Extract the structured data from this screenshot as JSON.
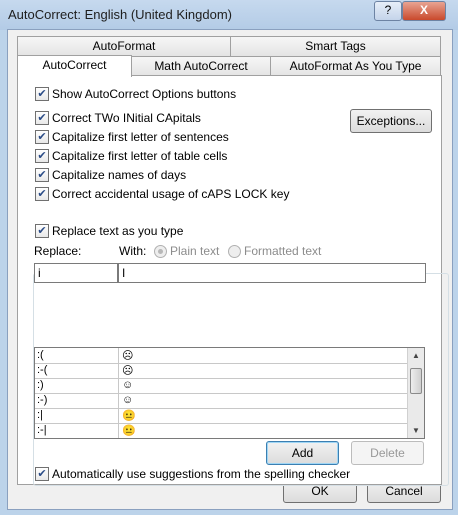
{
  "window": {
    "title": "AutoCorrect: English (United Kingdom)",
    "help_label": "?",
    "close_label": "X"
  },
  "tabs": [
    {
      "label": "AutoFormat"
    },
    {
      "label": "Smart Tags"
    },
    {
      "label": "AutoCorrect"
    },
    {
      "label": "Math AutoCorrect"
    },
    {
      "label": "AutoFormat As You Type"
    }
  ],
  "options": {
    "show_buttons": {
      "label": "Show AutoCorrect Options buttons",
      "checked": true
    },
    "two_initial_caps": {
      "label": "Correct TWo INitial CApitals",
      "checked": true
    },
    "cap_sentences": {
      "label": "Capitalize first letter of sentences",
      "checked": true
    },
    "cap_table_cells": {
      "label": "Capitalize first letter of table cells",
      "checked": true
    },
    "cap_days": {
      "label": "Capitalize names of days",
      "checked": true
    },
    "caps_lock": {
      "label": "Correct accidental usage of cAPS LOCK key",
      "checked": true
    },
    "replace_as_you_type": {
      "label": "Replace text as you type",
      "checked": true
    },
    "spelling_suggestions": {
      "label": "Automatically use suggestions from the spelling checker",
      "checked": true
    }
  },
  "exceptions_label": "Exceptions...",
  "replace_label": "Replace:",
  "with_label": "With:",
  "plain_text_label": "Plain text",
  "formatted_text_label": "Formatted text",
  "replace_value": "i",
  "with_value": "I",
  "list_rows": [
    {
      "replace": ":(",
      "with": "☹"
    },
    {
      "replace": ":-(",
      "with": "☹"
    },
    {
      "replace": ":)",
      "with": "☺"
    },
    {
      "replace": ":-)",
      "with": "☺"
    },
    {
      "replace": ":|",
      "with": "😐"
    },
    {
      "replace": ":-|",
      "with": "😐"
    }
  ],
  "add_label": "Add",
  "delete_label": "Delete",
  "ok_label": "OK",
  "cancel_label": "Cancel"
}
